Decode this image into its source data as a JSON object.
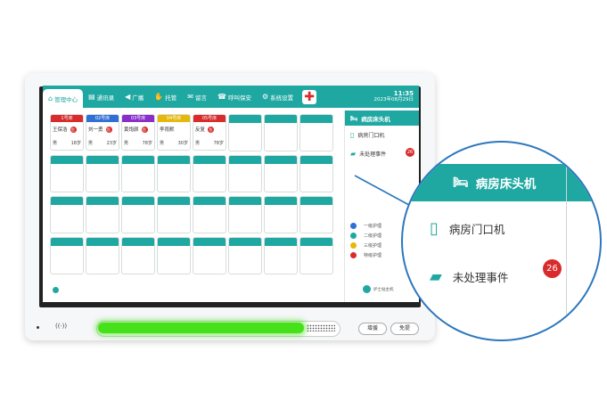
{
  "nav": {
    "items": [
      {
        "label": "管理中心",
        "icon": "home-icon",
        "active": true
      },
      {
        "label": "通讯录",
        "icon": "contacts-icon",
        "active": false
      },
      {
        "label": "广播",
        "icon": "broadcast-icon",
        "active": false
      },
      {
        "label": "托管",
        "icon": "handover-icon",
        "active": false
      },
      {
        "label": "留言",
        "icon": "message-icon",
        "active": false
      },
      {
        "label": "呼叫保安",
        "icon": "call-security-icon",
        "active": false
      },
      {
        "label": "系统设置",
        "icon": "settings-icon",
        "active": false
      }
    ],
    "time": "11:35",
    "date": "2023年08月29日"
  },
  "beds": [
    {
      "bed": "1号床",
      "header_color": "#d92b2b",
      "patient": "王保浩",
      "badge": "危",
      "age_label": "男",
      "age": "18岁"
    },
    {
      "bed": "02号床",
      "header_color": "#2f6fd6",
      "patient": "刘一勇",
      "badge": "危",
      "age_label": "男",
      "age": "23岁"
    },
    {
      "bed": "03号床",
      "header_color": "#8a2ec9",
      "patient": "黄饱颜",
      "badge": "危",
      "age_label": "男",
      "age": "78岁"
    },
    {
      "bed": "04号床",
      "header_color": "#e5b80b",
      "patient": "李雨默",
      "badge": "",
      "age_label": "男",
      "age": "30岁"
    },
    {
      "bed": "05号床",
      "header_color": "#d92b2b",
      "patient": "反复",
      "badge": "危",
      "age_label": "男",
      "age": "78岁"
    }
  ],
  "panel": {
    "title": "病房床头机",
    "door_label": "病房门口机",
    "events_label": "未处理事件",
    "events_count": "26",
    "legend": [
      {
        "label": "一级护理",
        "color": "#2f6fd6"
      },
      {
        "label": "二级护理",
        "color": "#1fa8a2"
      },
      {
        "label": "三级护理",
        "color": "#e5b80b"
      },
      {
        "label": "特级护理",
        "color": "#d92b2b"
      }
    ],
    "nurse_label": "护士站主机"
  },
  "hardware": {
    "nfc_label": "((·))",
    "btn_add": "增援",
    "btn_cancel": "免提"
  },
  "zoom": {
    "title": "病房床头机",
    "door_label": "病房门口机",
    "events_label": "未处理事件",
    "events_count": "26"
  }
}
